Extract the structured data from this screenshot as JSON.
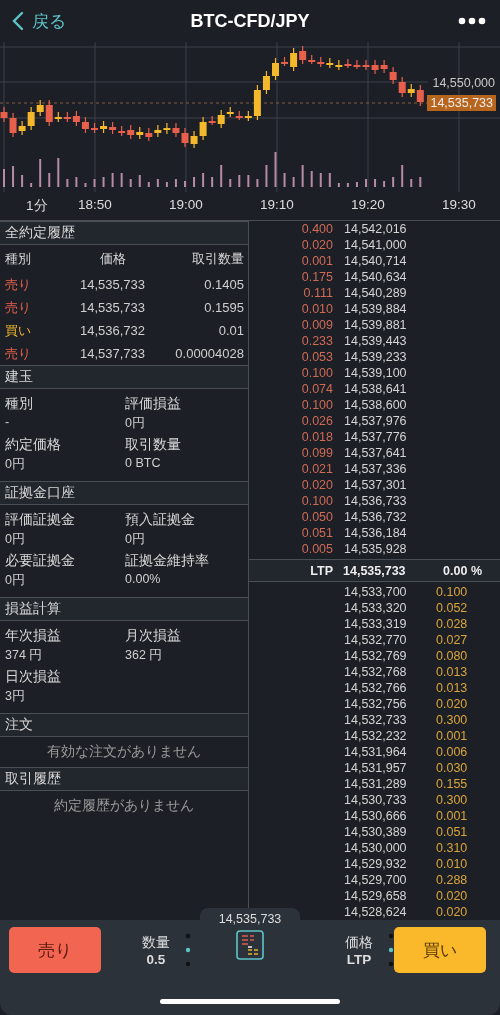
{
  "header": {
    "back_label": "戻る",
    "title": "BTC-CFD/JPY"
  },
  "chart": {
    "price_label": "14,550,000",
    "current_price": "14,535,733",
    "interval": "1分",
    "time_labels": [
      "18:50",
      "19:00",
      "19:10",
      "19:20",
      "19:30"
    ]
  },
  "trades": {
    "title": "全約定履歴",
    "columns": [
      "種別",
      "価格",
      "取引数量"
    ],
    "rows": [
      {
        "side": "売り",
        "kind": "sell",
        "price": "14,535,733",
        "amount": "0.1405"
      },
      {
        "side": "売り",
        "kind": "sell",
        "price": "14,535,733",
        "amount": "0.1595"
      },
      {
        "side": "買い",
        "kind": "buy",
        "price": "14,536,732",
        "amount": "0.01"
      },
      {
        "side": "売り",
        "kind": "sell",
        "price": "14,537,733",
        "amount": "0.00004028"
      }
    ]
  },
  "position": {
    "title": "建玉",
    "fields": [
      {
        "label": "種別",
        "value": "-"
      },
      {
        "label": "評価損益",
        "value": "0円"
      },
      {
        "label": "約定価格",
        "value": "0円"
      },
      {
        "label": "取引数量",
        "value": "0 BTC"
      }
    ]
  },
  "margin": {
    "title": "証拠金口座",
    "fields": [
      {
        "label": "評価証拠金",
        "value": "0円"
      },
      {
        "label": "預入証拠金",
        "value": "0円"
      },
      {
        "label": "必要証拠金",
        "value": "0円"
      },
      {
        "label": "証拠金維持率",
        "value": "0.00%"
      }
    ]
  },
  "pnl": {
    "title": "損益計算",
    "fields": [
      {
        "label": "年次損益",
        "value": "374 円"
      },
      {
        "label": "月次損益",
        "value": "362 円"
      },
      {
        "label": "日次損益",
        "value": "3円"
      }
    ]
  },
  "orders": {
    "title": "注文",
    "empty": "有効な注文がありません"
  },
  "history": {
    "title": "取引履歴",
    "empty": "約定履歴がありません"
  },
  "order_book": {
    "asks": [
      {
        "size": "0.400",
        "price": "14,542,016"
      },
      {
        "size": "0.020",
        "price": "14,541,000"
      },
      {
        "size": "0.001",
        "price": "14,540,714"
      },
      {
        "size": "0.175",
        "price": "14,540,634"
      },
      {
        "size": "0.111",
        "price": "14,540,289"
      },
      {
        "size": "0.010",
        "price": "14,539,884"
      },
      {
        "size": "0.009",
        "price": "14,539,881"
      },
      {
        "size": "0.233",
        "price": "14,539,443"
      },
      {
        "size": "0.053",
        "price": "14,539,233"
      },
      {
        "size": "0.100",
        "price": "14,539,100"
      },
      {
        "size": "0.074",
        "price": "14,538,641"
      },
      {
        "size": "0.100",
        "price": "14,538,600"
      },
      {
        "size": "0.026",
        "price": "14,537,976"
      },
      {
        "size": "0.018",
        "price": "14,537,776"
      },
      {
        "size": "0.099",
        "price": "14,537,641"
      },
      {
        "size": "0.021",
        "price": "14,537,336"
      },
      {
        "size": "0.020",
        "price": "14,537,301"
      },
      {
        "size": "0.100",
        "price": "14,536,733"
      },
      {
        "size": "0.050",
        "price": "14,536,732"
      },
      {
        "size": "0.051",
        "price": "14,536,184"
      },
      {
        "size": "0.005",
        "price": "14,535,928"
      }
    ],
    "ltp": {
      "label": "LTP",
      "price": "14,535,733",
      "change": "0.00 %"
    },
    "bids": [
      {
        "price": "14,533,700",
        "size": "0.100"
      },
      {
        "price": "14,533,320",
        "size": "0.052"
      },
      {
        "price": "14,533,319",
        "size": "0.028"
      },
      {
        "price": "14,532,770",
        "size": "0.027"
      },
      {
        "price": "14,532,769",
        "size": "0.080"
      },
      {
        "price": "14,532,768",
        "size": "0.013"
      },
      {
        "price": "14,532,766",
        "size": "0.013"
      },
      {
        "price": "14,532,756",
        "size": "0.020"
      },
      {
        "price": "14,532,733",
        "size": "0.300"
      },
      {
        "price": "14,532,232",
        "size": "0.001"
      },
      {
        "price": "14,531,964",
        "size": "0.006"
      },
      {
        "price": "14,531,957",
        "size": "0.030"
      },
      {
        "price": "14,531,289",
        "size": "0.155"
      },
      {
        "price": "14,530,733",
        "size": "0.300"
      },
      {
        "price": "14,530,666",
        "size": "0.001"
      },
      {
        "price": "14,530,389",
        "size": "0.051"
      },
      {
        "price": "14,530,000",
        "size": "0.310"
      },
      {
        "price": "14,529,932",
        "size": "0.010"
      },
      {
        "price": "14,529,700",
        "size": "0.288"
      },
      {
        "price": "14,529,658",
        "size": "0.020"
      },
      {
        "price": "14,528,624",
        "size": "0.020"
      }
    ]
  },
  "footer": {
    "sell_button": "売り",
    "quantity": {
      "label": "数量",
      "value": "0.5"
    },
    "center_price": "14,535,733",
    "price": {
      "label": "価格",
      "value": "LTP"
    },
    "buy_button": "買い"
  }
}
